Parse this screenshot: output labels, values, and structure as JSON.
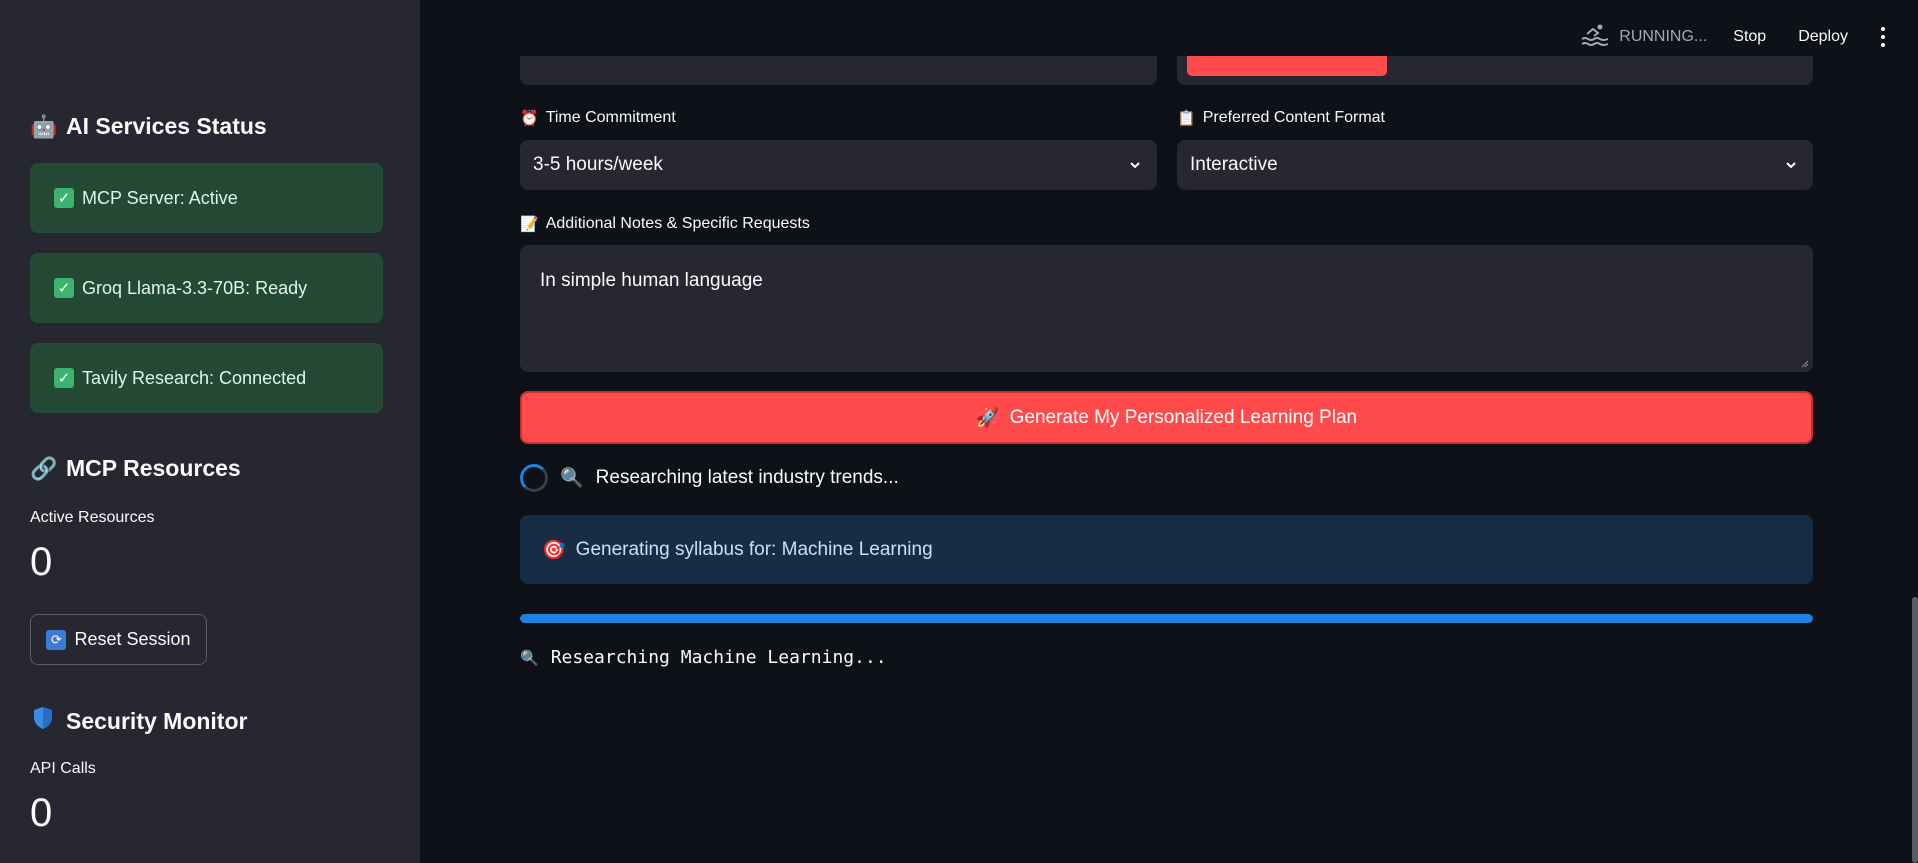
{
  "sidebar": {
    "services_heading": "AI Services Status",
    "services_icon": "robot-icon",
    "services": [
      {
        "label": "MCP Server: Active"
      },
      {
        "label": "Groq Llama-3.3-70B: Ready"
      },
      {
        "label": "Tavily Research: Connected"
      }
    ],
    "resources_heading": "MCP Resources",
    "resources_icon": "link-icon",
    "active_resources_label": "Active Resources",
    "active_resources_value": "0",
    "reset_label": "Reset Session",
    "security_heading": "Security Monitor",
    "security_icon": "shield-icon",
    "api_calls_label": "API Calls",
    "api_calls_value": "0"
  },
  "header": {
    "status_text": "RUNNING...",
    "stop_label": "Stop",
    "deploy_label": "Deploy"
  },
  "form": {
    "time_label": "Time Commitment",
    "time_value": "3-5 hours/week",
    "format_label": "Preferred Content Format",
    "format_value": "Interactive",
    "notes_label": "Additional Notes & Specific Requests",
    "notes_value": "In simple human language",
    "generate_label": "Generate My Personalized Learning Plan"
  },
  "progress": {
    "spinner_text": "Researching latest industry trends...",
    "info_text": "Generating syllabus for: Machine Learning",
    "fraction": 1.0,
    "code_text": "Researching Machine Learning..."
  },
  "colors": {
    "accent_red": "#ff4b4b",
    "success_bg": "#244a35",
    "info_bg": "#172d43",
    "progress_blue": "#1c83e1"
  }
}
